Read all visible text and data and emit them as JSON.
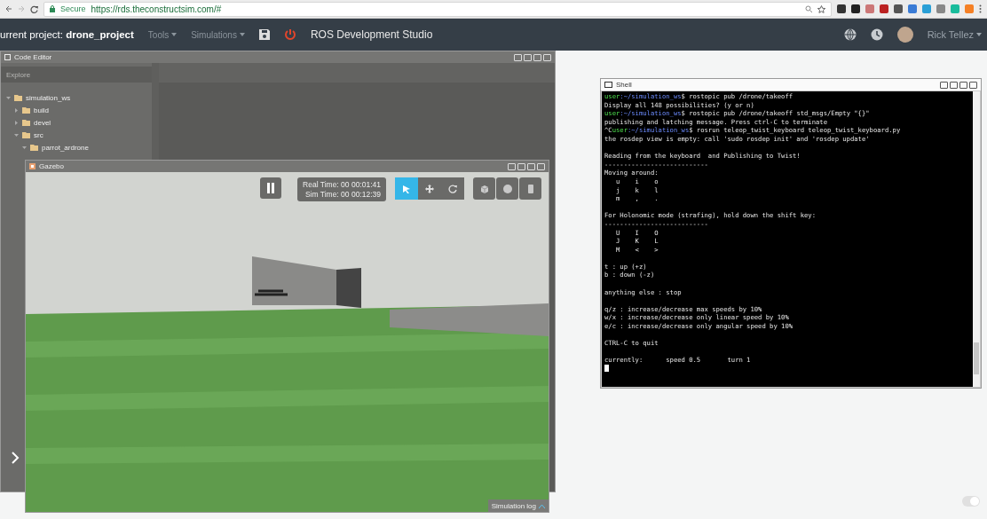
{
  "browser": {
    "secure_label": "Secure",
    "url": "https://rds.theconstructsim.com/#"
  },
  "header": {
    "project": "urrent project: **drone_project**",
    "menus": [
      {
        "label": "Tools"
      },
      {
        "label": "Simulations"
      }
    ],
    "title": "ROS Development Studio",
    "user": "Rick Tellez"
  },
  "code_editor": {
    "title": "Code Editor",
    "explorer_placeholder": "Explore",
    "tree": [
      {
        "label": "simulation_ws",
        "expanded": true,
        "children": [
          {
            "label": "build",
            "expanded": false
          },
          {
            "label": "devel",
            "expanded": false
          },
          {
            "label": "src",
            "expanded": true,
            "children": [
              {
                "label": "parrot_ardrone",
                "expanded": true
              }
            ]
          }
        ]
      }
    ]
  },
  "gazebo": {
    "title": "Gazebo",
    "paused": false,
    "real_time": "Real Time: 00 00:01:41",
    "sim_time": "Sim Time: 00 00:12:39",
    "tools": [
      {
        "kind": "select",
        "selected": true
      },
      {
        "kind": "translate",
        "selected": false
      },
      {
        "kind": "rotate",
        "selected": false
      }
    ],
    "shapes": [
      {
        "kind": "box"
      },
      {
        "kind": "sphere"
      },
      {
        "kind": "cylinder"
      }
    ],
    "log_label": "Simulation log"
  },
  "shell": {
    "title": "Shell",
    "lines": [
      {
        "kind": "prompt",
        "user": "user",
        "path": ":~/simulation_ws",
        "command": "$ rostopic pub /drone/takeoff"
      },
      {
        "kind": "text",
        "text": "Display all 148 possibilities? (y or n)"
      },
      {
        "kind": "prompt",
        "user": "user",
        "path": ":~/simulation_ws",
        "command": "$ rostopic pub /drone/takeoff std_msgs/Empty \"{}\""
      },
      {
        "kind": "text",
        "text": "publishing and latching message. Press ctrl-C to terminate"
      },
      {
        "kind": "prompt",
        "prefix": "^C",
        "user": "user",
        "path": ":~/simulation_ws",
        "command": "$ rosrun teleop_twist_keyboard teleop_twist_keyboard.py"
      },
      {
        "kind": "text",
        "text": "the rosdep view is empty: call 'sudo rosdep init' and 'rosdep update'"
      },
      {
        "kind": "blank"
      },
      {
        "kind": "text",
        "text": "Reading from the keyboard  and Publishing to Twist!"
      },
      {
        "kind": "text",
        "text": "---------------------------"
      },
      {
        "kind": "text",
        "text": "Moving around:"
      },
      {
        "kind": "text",
        "text": "   u    i    o"
      },
      {
        "kind": "text",
        "text": "   j    k    l"
      },
      {
        "kind": "text",
        "text": "   m    ,    ."
      },
      {
        "kind": "blank"
      },
      {
        "kind": "text",
        "text": "For Holonomic mode (strafing), hold down the shift key:"
      },
      {
        "kind": "text",
        "text": "---------------------------"
      },
      {
        "kind": "text",
        "text": "   U    I    O"
      },
      {
        "kind": "text",
        "text": "   J    K    L"
      },
      {
        "kind": "text",
        "text": "   M    <    >"
      },
      {
        "kind": "blank"
      },
      {
        "kind": "text",
        "text": "t : up (+z)"
      },
      {
        "kind": "text",
        "text": "b : down (-z)"
      },
      {
        "kind": "blank"
      },
      {
        "kind": "text",
        "text": "anything else : stop"
      },
      {
        "kind": "blank"
      },
      {
        "kind": "text",
        "text": "q/z : increase/decrease max speeds by 10%"
      },
      {
        "kind": "text",
        "text": "w/x : increase/decrease only linear speed by 10%"
      },
      {
        "kind": "text",
        "text": "e/c : increase/decrease only angular speed by 10%"
      },
      {
        "kind": "blank"
      },
      {
        "kind": "text",
        "text": "CTRL-C to quit"
      },
      {
        "kind": "blank"
      },
      {
        "kind": "text",
        "text": "currently:      speed 0.5       turn 1"
      },
      {
        "kind": "cursor"
      }
    ]
  }
}
